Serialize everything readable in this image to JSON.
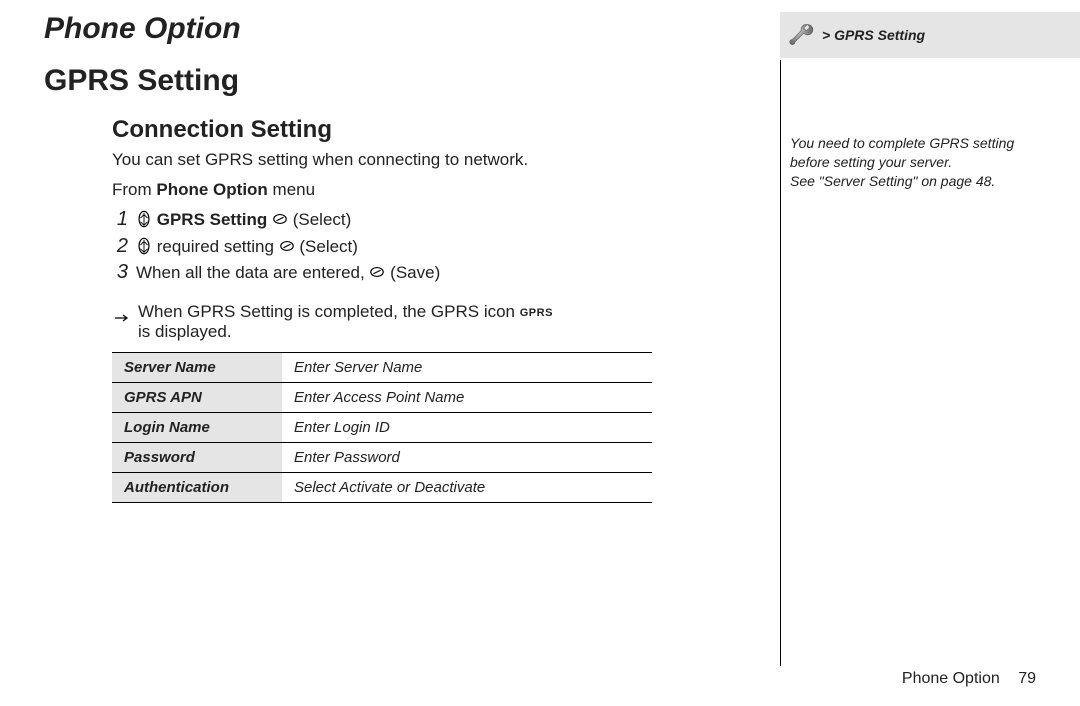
{
  "sidebar": {
    "crumb": "> GPRS Setting",
    "note": "You need to complete GPRS setting before setting your server.\nSee \"Server Setting\" on page 48."
  },
  "chapter": "Phone Option",
  "h1": "GPRS Setting",
  "section": {
    "h2": "Connection Setting",
    "intro": "You can set GPRS setting when connecting to network.",
    "from_prefix": "From ",
    "from_bold": "Phone Option",
    "from_suffix": " menu",
    "steps": [
      {
        "n": "1",
        "pre": "",
        "bold": "GPRS Setting",
        "post": " ",
        "action": "(Select)",
        "nav": true
      },
      {
        "n": "2",
        "pre": " required setting ",
        "bold": "",
        "post": "",
        "action": "(Select)",
        "nav": true
      },
      {
        "n": "3",
        "pre": "When all the data are entered, ",
        "bold": "",
        "post": "",
        "action": "(Save)",
        "nav": false
      }
    ],
    "note_line_1": "When GPRS Setting is completed, the GPRS icon ",
    "note_line_gprs": "GPRS",
    "note_line_2": "is displayed.",
    "table": [
      {
        "label": "Server Name",
        "value": "Enter Server Name"
      },
      {
        "label": "GPRS APN",
        "value": "Enter Access Point Name"
      },
      {
        "label": "Login Name",
        "value": "Enter Login ID"
      },
      {
        "label": "Password",
        "value": "Enter Password"
      },
      {
        "label": "Authentication",
        "value": "Select Activate or Deactivate"
      }
    ]
  },
  "footer": {
    "section": "Phone Option",
    "page": "79"
  }
}
